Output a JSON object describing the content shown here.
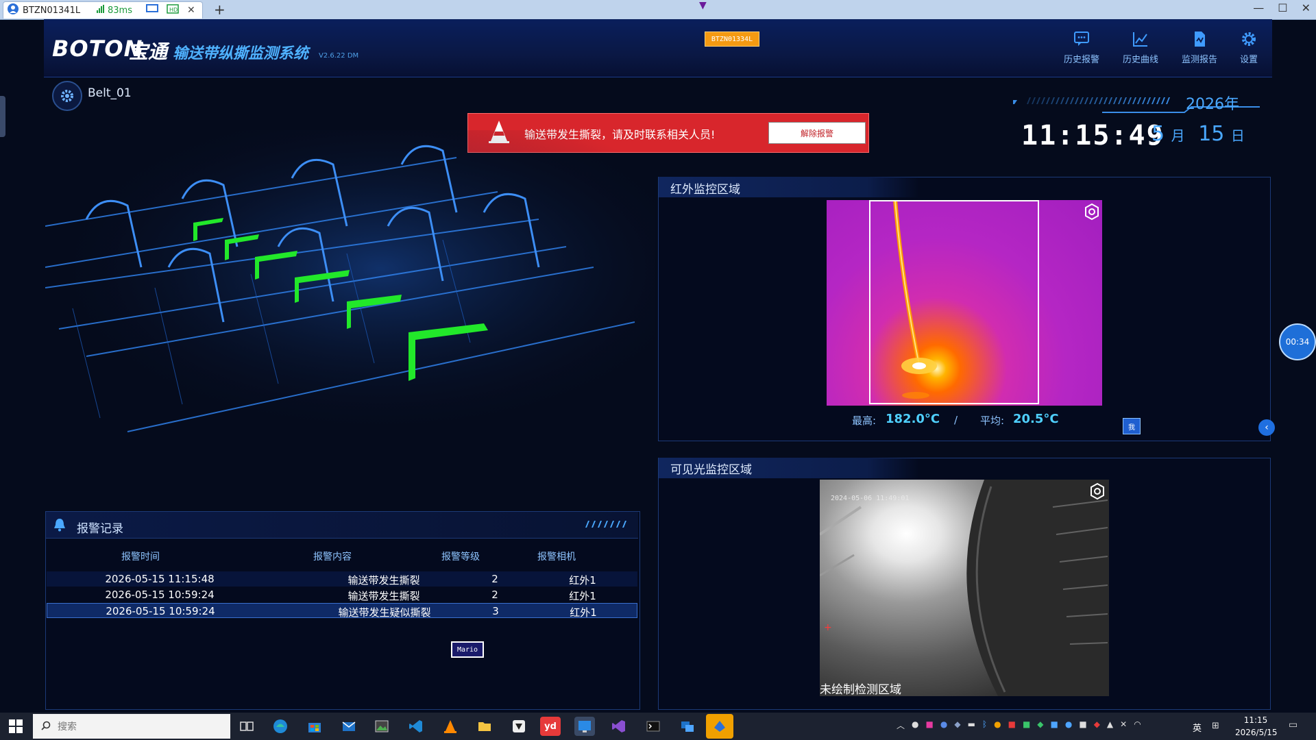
{
  "remote_tab": {
    "title": "BTZN01341L",
    "latency": "83ms"
  },
  "header": {
    "logo_en": "BOTON",
    "logo_cn": "宝通",
    "system_title": "输送带纵撕监测系统",
    "version": "V2.6.22 DM",
    "camera_badge": "BTZN01334L",
    "nav": [
      {
        "label": "历史报警",
        "icon": "chat-alert-icon"
      },
      {
        "label": "历史曲线",
        "icon": "line-chart-icon"
      },
      {
        "label": "监测报告",
        "icon": "report-icon"
      },
      {
        "label": "设置",
        "icon": "gear-icon"
      }
    ]
  },
  "belt": {
    "name": "Belt_01"
  },
  "alarm": {
    "message": "输送带发生撕裂，请及时联系相关人员!",
    "dismiss_label": "解除报警"
  },
  "clock": {
    "year": "2026年",
    "time": "11:15:49",
    "month": "5",
    "month_unit": "月",
    "day": "15",
    "day_unit": "日"
  },
  "records": {
    "title": "报警记录",
    "columns": [
      "报警时间",
      "报警内容",
      "报警等级",
      "报警相机"
    ],
    "rows": [
      {
        "time": "2026-05-15 11:15:48",
        "content": "输送带发生撕裂",
        "level": "2",
        "camera": "红外1"
      },
      {
        "time": "2026-05-15 10:59:24",
        "content": "输送带发生撕裂",
        "level": "2",
        "camera": "红外1"
      },
      {
        "time": "2026-05-15 10:59:24",
        "content": "输送带发生疑似撕裂",
        "level": "3",
        "camera": "红外1"
      }
    ],
    "badge": "Mario"
  },
  "ir": {
    "title": "红外监控区域",
    "max_label": "最高:",
    "max_value": "182.0°C",
    "separator": "/",
    "avg_label": "平均:",
    "avg_value": "20.5°C",
    "small_button": "我"
  },
  "visible": {
    "title": "可见光监控区域",
    "timestamp": "2024-05-06 11:49:01",
    "caption": "未绘制检测区域"
  },
  "timer": "00:34",
  "taskbar": {
    "search_placeholder": "搜索",
    "time": "11:15",
    "date": "2026/5/15",
    "ime": "英"
  },
  "colors": {
    "accent": "#4aa8ff",
    "alarm": "#d8262c",
    "header_bg": "#0a1f5c"
  }
}
